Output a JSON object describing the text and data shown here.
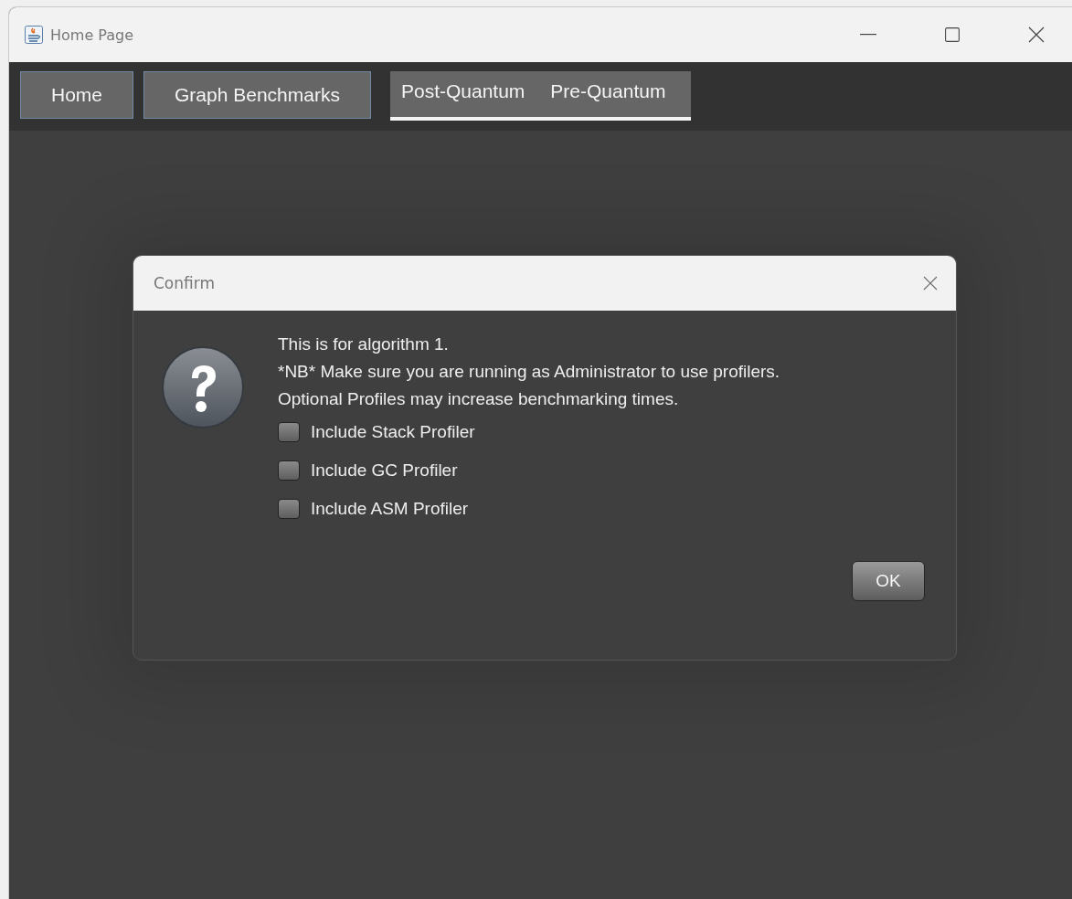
{
  "window": {
    "title": "Home Page"
  },
  "nav_buttons": [
    {
      "label": "Home"
    },
    {
      "label": "Graph Benchmarks"
    }
  ],
  "tab_group": {
    "selected": true,
    "tabs": [
      {
        "label": "Post-Quantum"
      },
      {
        "label": "Pre-Quantum"
      }
    ]
  },
  "dialog": {
    "title": "Confirm",
    "messages": [
      "This is for algorithm 1.",
      "*NB* Make sure you are running as Administrator to use profilers.",
      "Optional Profiles may increase benchmarking times."
    ],
    "options": [
      {
        "label": "Include Stack Profiler",
        "checked": false
      },
      {
        "label": "Include GC Profiler",
        "checked": false
      },
      {
        "label": "Include ASM Profiler",
        "checked": false
      }
    ],
    "buttons": [
      "OK"
    ]
  }
}
